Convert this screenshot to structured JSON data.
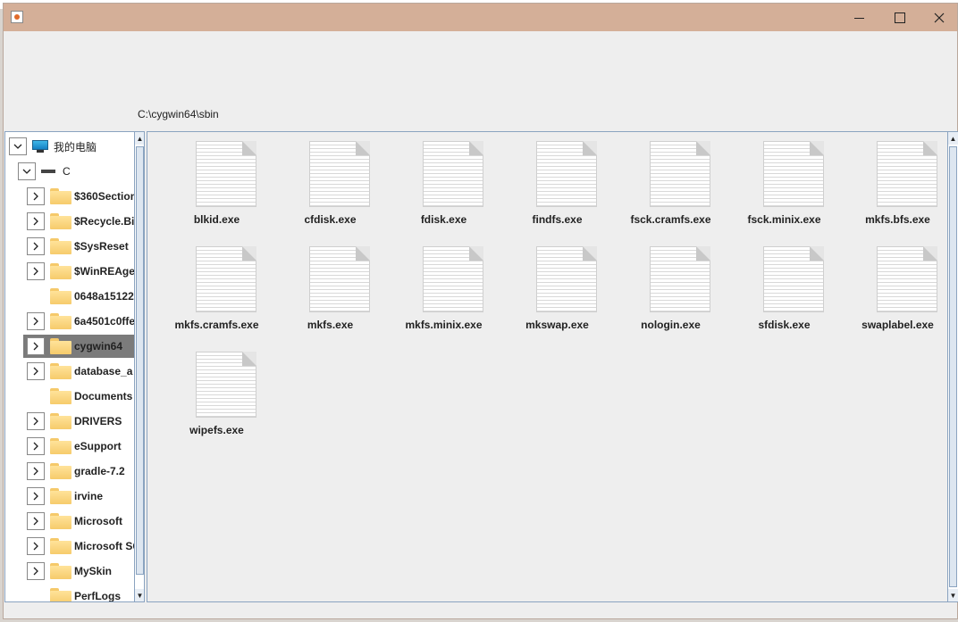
{
  "path": "C:\\cygwin64\\sbin",
  "tree": [
    {
      "label": "我的电脑",
      "toggle": "expanded",
      "icon": "pc-icon",
      "depth": 0
    },
    {
      "label": "C",
      "toggle": "expanded",
      "icon": "drive-icon",
      "depth": 1
    },
    {
      "label": "$360Section",
      "toggle": "collapsed",
      "icon": "folder-icon",
      "depth": 2
    },
    {
      "label": "$Recycle.Bin",
      "toggle": "collapsed",
      "icon": "folder-icon",
      "depth": 2
    },
    {
      "label": "$SysReset",
      "toggle": "collapsed",
      "icon": "folder-icon",
      "depth": 2
    },
    {
      "label": "$WinREAgent",
      "toggle": "collapsed",
      "icon": "folder-icon",
      "depth": 2
    },
    {
      "label": "0648a15122",
      "toggle": "none",
      "icon": "folder-icon",
      "depth": 2
    },
    {
      "label": "6a4501c0ffe",
      "toggle": "collapsed",
      "icon": "folder-icon",
      "depth": 2
    },
    {
      "label": "cygwin64",
      "toggle": "collapsed",
      "icon": "folder-icon",
      "depth": 2,
      "selected": true
    },
    {
      "label": "database_a",
      "toggle": "collapsed",
      "icon": "folder-icon",
      "depth": 2
    },
    {
      "label": "Documents",
      "toggle": "none",
      "icon": "folder-icon",
      "depth": 2
    },
    {
      "label": "DRIVERS",
      "toggle": "collapsed",
      "icon": "folder-icon",
      "depth": 2
    },
    {
      "label": "eSupport",
      "toggle": "collapsed",
      "icon": "folder-icon",
      "depth": 2
    },
    {
      "label": "gradle-7.2",
      "toggle": "collapsed",
      "icon": "folder-icon",
      "depth": 2
    },
    {
      "label": "irvine",
      "toggle": "collapsed",
      "icon": "folder-icon",
      "depth": 2
    },
    {
      "label": "Microsoft",
      "toggle": "collapsed",
      "icon": "folder-icon",
      "depth": 2
    },
    {
      "label": "Microsoft SQL",
      "toggle": "collapsed",
      "icon": "folder-icon",
      "depth": 2
    },
    {
      "label": "MySkin",
      "toggle": "collapsed",
      "icon": "folder-icon",
      "depth": 2
    },
    {
      "label": "PerfLogs",
      "toggle": "none",
      "icon": "folder-icon",
      "depth": 2
    }
  ],
  "files": [
    "blkid.exe",
    "cfdisk.exe",
    "fdisk.exe",
    "findfs.exe",
    "fsck.cramfs.exe",
    "fsck.minix.exe",
    "mkfs.bfs.exe",
    "mkfs.cramfs.exe",
    "mkfs.exe",
    "mkfs.minix.exe",
    "mkswap.exe",
    "nologin.exe",
    "sfdisk.exe",
    "swaplabel.exe",
    "wipefs.exe"
  ],
  "colors": {
    "titlebar": "#d4af98",
    "selection": "#7b7b7b",
    "border": "#8aa3c0"
  }
}
